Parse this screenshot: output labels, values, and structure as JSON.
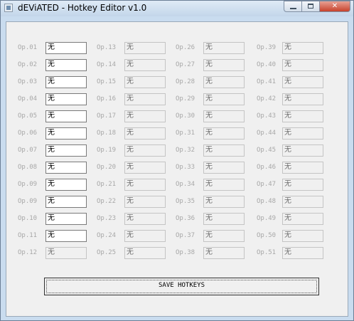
{
  "window": {
    "title": "dEViATED - Hotkey Editor v1.0",
    "controls": {
      "minimize": "",
      "maximize": "",
      "close": "✕"
    }
  },
  "columns": [
    {
      "items": [
        {
          "label": "Op.01",
          "value": "无",
          "enabled": true
        },
        {
          "label": "Op.02",
          "value": "无",
          "enabled": true
        },
        {
          "label": "Op.03",
          "value": "无",
          "enabled": true
        },
        {
          "label": "Op.04",
          "value": "无",
          "enabled": true
        },
        {
          "label": "Op.05",
          "value": "无",
          "enabled": true
        },
        {
          "label": "Op.06",
          "value": "无",
          "enabled": true
        },
        {
          "label": "Op.07",
          "value": "无",
          "enabled": true
        },
        {
          "label": "Op.08",
          "value": "无",
          "enabled": true
        },
        {
          "label": "Op.09",
          "value": "无",
          "enabled": true
        },
        {
          "label": "Op.09",
          "value": "无",
          "enabled": true
        },
        {
          "label": "Op.10",
          "value": "无",
          "enabled": true
        },
        {
          "label": "Op.11",
          "value": "无",
          "enabled": true
        },
        {
          "label": "Op.12",
          "value": "无",
          "enabled": false
        }
      ]
    },
    {
      "items": [
        {
          "label": "Op.13",
          "value": "无",
          "enabled": false
        },
        {
          "label": "Op.14",
          "value": "无",
          "enabled": false
        },
        {
          "label": "Op.15",
          "value": "无",
          "enabled": false
        },
        {
          "label": "Op.16",
          "value": "无",
          "enabled": false
        },
        {
          "label": "Op.17",
          "value": "无",
          "enabled": false
        },
        {
          "label": "Op.18",
          "value": "无",
          "enabled": false
        },
        {
          "label": "Op.19",
          "value": "无",
          "enabled": false
        },
        {
          "label": "Op.20",
          "value": "无",
          "enabled": false
        },
        {
          "label": "Op.21",
          "value": "无",
          "enabled": false
        },
        {
          "label": "Op.22",
          "value": "无",
          "enabled": false
        },
        {
          "label": "Op.23",
          "value": "无",
          "enabled": false
        },
        {
          "label": "Op.24",
          "value": "无",
          "enabled": false
        },
        {
          "label": "Op.25",
          "value": "无",
          "enabled": false
        }
      ]
    },
    {
      "items": [
        {
          "label": "Op.26",
          "value": "无",
          "enabled": false
        },
        {
          "label": "Op.27",
          "value": "无",
          "enabled": false
        },
        {
          "label": "Op.28",
          "value": "无",
          "enabled": false
        },
        {
          "label": "Op.29",
          "value": "无",
          "enabled": false
        },
        {
          "label": "Op.30",
          "value": "无",
          "enabled": false
        },
        {
          "label": "Op.31",
          "value": "无",
          "enabled": false
        },
        {
          "label": "Op.32",
          "value": "无",
          "enabled": false
        },
        {
          "label": "Op.33",
          "value": "无",
          "enabled": false
        },
        {
          "label": "Op.34",
          "value": "无",
          "enabled": false
        },
        {
          "label": "Op.35",
          "value": "无",
          "enabled": false
        },
        {
          "label": "Op.36",
          "value": "无",
          "enabled": false
        },
        {
          "label": "Op.37",
          "value": "无",
          "enabled": false
        },
        {
          "label": "Op.38",
          "value": "无",
          "enabled": false
        }
      ]
    },
    {
      "items": [
        {
          "label": "Op.39",
          "value": "无",
          "enabled": false
        },
        {
          "label": "Op.40",
          "value": "无",
          "enabled": false
        },
        {
          "label": "Op.41",
          "value": "无",
          "enabled": false
        },
        {
          "label": "Op.42",
          "value": "无",
          "enabled": false
        },
        {
          "label": "Op.43",
          "value": "无",
          "enabled": false
        },
        {
          "label": "Op.44",
          "value": "无",
          "enabled": false
        },
        {
          "label": "Op.45",
          "value": "无",
          "enabled": false
        },
        {
          "label": "Op.46",
          "value": "无",
          "enabled": false
        },
        {
          "label": "Op.47",
          "value": "无",
          "enabled": false
        },
        {
          "label": "Op.48",
          "value": "无",
          "enabled": false
        },
        {
          "label": "Op.49",
          "value": "无",
          "enabled": false
        },
        {
          "label": "Op.50",
          "value": "无",
          "enabled": false
        },
        {
          "label": "Op.51",
          "value": "无",
          "enabled": false
        }
      ]
    }
  ],
  "save_button": {
    "label": "SAVE HOTKEYS"
  },
  "colors": {
    "frame": "#c9dcef",
    "client": "#f0f0f0",
    "label_text": "#a8a8a8",
    "close_button": "#c7422c"
  }
}
